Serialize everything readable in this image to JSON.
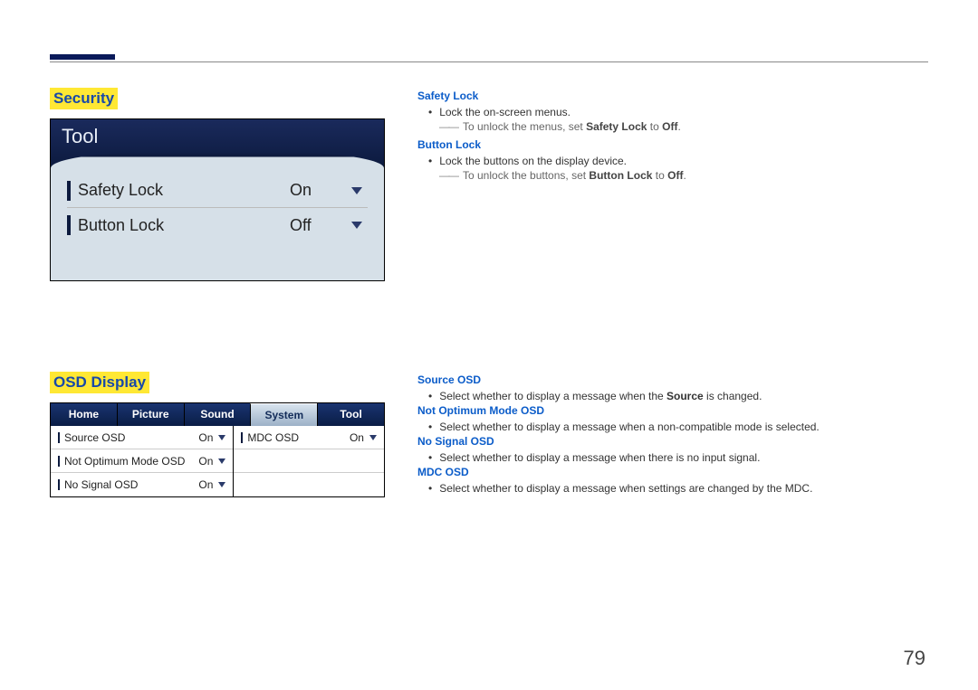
{
  "page_number": "79",
  "sections": {
    "security": {
      "title": "Security",
      "panel": {
        "header": "Tool",
        "rows": [
          {
            "label": "Safety Lock",
            "value": "On"
          },
          {
            "label": "Button Lock",
            "value": "Off"
          }
        ]
      },
      "desc": {
        "h1": "Safety Lock",
        "b1": "Lock the on-screen menus.",
        "n1_pre": "To unlock the menus, set ",
        "n1_bold": "Safety Lock",
        "n1_mid": " to ",
        "n1_bold2": "Off",
        "n1_end": ".",
        "h2": "Button Lock",
        "b2": "Lock the buttons on the display device.",
        "n2_pre": "To unlock the buttons, set ",
        "n2_bold": "Button Lock",
        "n2_mid": " to ",
        "n2_bold2": "Off",
        "n2_end": "."
      }
    },
    "osd": {
      "title": "OSD Display",
      "tabs": [
        "Home",
        "Picture",
        "Sound",
        "System",
        "Tool"
      ],
      "active_tab_index": 3,
      "left_items": [
        {
          "label": "Source OSD",
          "value": "On"
        },
        {
          "label": "Not Optimum Mode OSD",
          "value": "On"
        },
        {
          "label": "No Signal OSD",
          "value": "On"
        }
      ],
      "right_items": [
        {
          "label": "MDC OSD",
          "value": "On"
        }
      ],
      "desc": {
        "h1": "Source OSD",
        "b1_pre": "Select whether to display a message when the ",
        "b1_bold": "Source",
        "b1_end": " is changed.",
        "h2": "Not Optimum Mode OSD",
        "b2": "Select whether to display a message when a non-compatible mode is selected.",
        "h3": "No Signal OSD",
        "b3": "Select whether to display a message when there is no input signal.",
        "h4": "MDC OSD",
        "b4": "Select whether to display a message when settings are changed by the MDC."
      }
    }
  }
}
